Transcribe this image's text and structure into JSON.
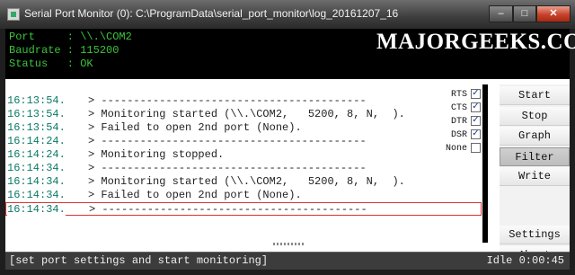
{
  "window": {
    "title": "Serial Port Monitor (0): C:\\ProgramData\\serial_port_monitor\\log_20161207_16",
    "minimize": "–",
    "maximize": "□",
    "close": "✕"
  },
  "status": {
    "port": "Port     : \\\\.\\COM2",
    "baudrate": "Baudrate : 115200",
    "status": "Status   : OK"
  },
  "brand": "MAJORGEEKS.COM",
  "log": [
    {
      "time": "16:13:54.",
      "msg": "> -----------------------------------------"
    },
    {
      "time": "16:13:54.",
      "msg": "> Monitoring started (\\\\.\\COM2,   5200, 8, N,  )."
    },
    {
      "time": "16:13:54.",
      "msg": "> Failed to open 2nd port (None)."
    },
    {
      "time": "16:14:24.",
      "msg": "> -----------------------------------------"
    },
    {
      "time": "16:14:24.",
      "msg": "> Monitoring stopped."
    },
    {
      "time": "16:14:34.",
      "msg": "> -----------------------------------------"
    },
    {
      "time": "16:14:34.",
      "msg": "> Monitoring started (\\\\.\\COM2,   5200, 8, N,  )."
    },
    {
      "time": "16:14:34.",
      "msg": "> Failed to open 2nd port (None)."
    },
    {
      "time": "16:14:34.",
      "msg": "> -----------------------------------------"
    }
  ],
  "signals": [
    {
      "label": "RTS",
      "checked": true
    },
    {
      "label": "CTS",
      "checked": true
    },
    {
      "label": "DTR",
      "checked": true
    },
    {
      "label": "DSR",
      "checked": true
    },
    {
      "label": "None",
      "checked": false
    }
  ],
  "buttons": {
    "start": "Start",
    "stop": "Stop",
    "graph": "Graph",
    "filter": "Filter",
    "write": "Write",
    "settings": "Settings",
    "about": "About"
  },
  "footer": {
    "hint": "[set port settings and start monitoring]",
    "idle": "Idle 0:00:45"
  }
}
